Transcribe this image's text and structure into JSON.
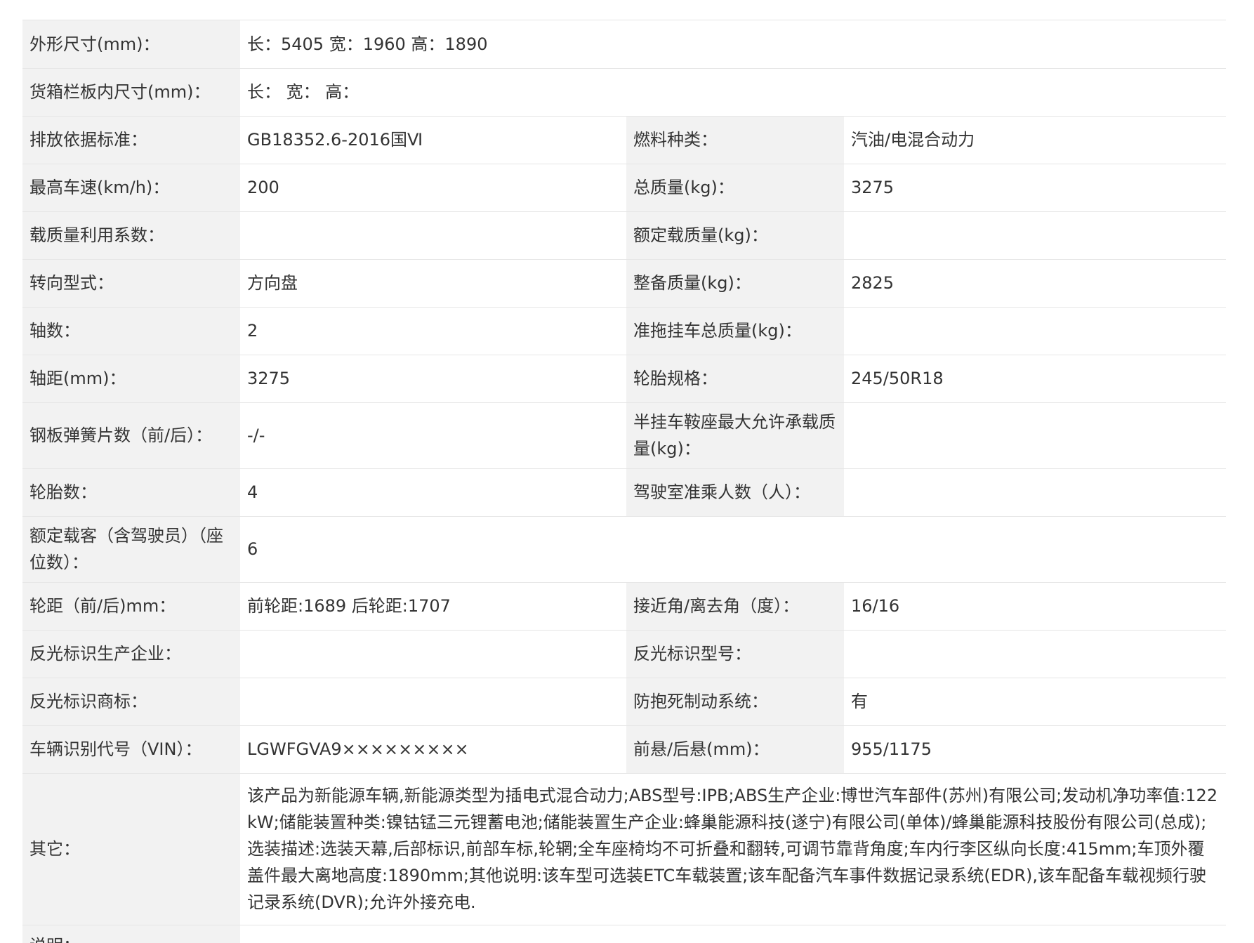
{
  "rows": [
    {
      "l1": "外形尺寸(mm)：",
      "v1": "长：5405 宽：1960 高：1890"
    },
    {
      "l1": "货箱栏板内尺寸(mm)：",
      "v1": "长：  宽：  高："
    },
    {
      "l1": "排放依据标准：",
      "v1": "GB18352.6-2016国Ⅵ",
      "l2": "燃料种类：",
      "v2": "汽油/电混合动力"
    },
    {
      "l1": "最高车速(km/h)：",
      "v1": "200",
      "l2": "总质量(kg)：",
      "v2": "3275"
    },
    {
      "l1": "载质量利用系数：",
      "v1": "",
      "l2": "额定载质量(kg)：",
      "v2": ""
    },
    {
      "l1": "转向型式：",
      "v1": "方向盘",
      "l2": "整备质量(kg)：",
      "v2": "2825"
    },
    {
      "l1": "轴数：",
      "v1": "2",
      "l2": "准拖挂车总质量(kg)：",
      "v2": ""
    },
    {
      "l1": "轴距(mm)：",
      "v1": "3275",
      "l2": "轮胎规格：",
      "v2": "245/50R18"
    },
    {
      "l1": "钢板弹簧片数（前/后）：",
      "v1": "-/-",
      "l2": "半挂车鞍座最大允许承载质量(kg)：",
      "v2": ""
    },
    {
      "l1": "轮胎数：",
      "v1": "4",
      "l2": "驾驶室准乘人数（人）：",
      "v2": ""
    },
    {
      "l1": "额定载客（含驾驶员）（座位数）：",
      "v1": "6"
    },
    {
      "l1": "轮距（前/后)mm：",
      "v1": "前轮距:1689 后轮距:1707",
      "l2": "接近角/离去角（度）：",
      "v2": "16/16"
    },
    {
      "l1": "反光标识生产企业：",
      "v1": "",
      "l2": "反光标识型号：",
      "v2": ""
    },
    {
      "l1": "反光标识商标：",
      "v1": "",
      "l2": "防抱死制动系统：",
      "v2": "有"
    },
    {
      "l1": "车辆识别代号（VIN）：",
      "v1": "LGWFGVA9×××××××××",
      "l2": "前悬/后悬(mm)：",
      "v2": "955/1175"
    },
    {
      "l1": "其它：",
      "v1": "该产品为新能源车辆,新能源类型为插电式混合动力;ABS型号:IPB;ABS生产企业:博世汽车部件(苏州)有限公司;发动机净功率值:122kW;储能装置种类:镍钴锰三元锂蓄电池;储能装置生产企业:蜂巢能源科技(遂宁)有限公司(单体)/蜂巢能源科技股份有限公司(总成);选装描述:选装天幕,后部标识,前部车标,轮辋;全车座椅均不可折叠和翻转,可调节靠背角度;车内行李区纵向长度:415mm;车顶外覆盖件最大离地高度:1890mm;其他说明:该车型可选装ETC车载装置;该车配备汽车事件数据记录系统(EDR),该车配备车载视频行驶记录系统(DVR);允许外接充电."
    },
    {
      "l1": "说明：",
      "v1": ""
    }
  ]
}
